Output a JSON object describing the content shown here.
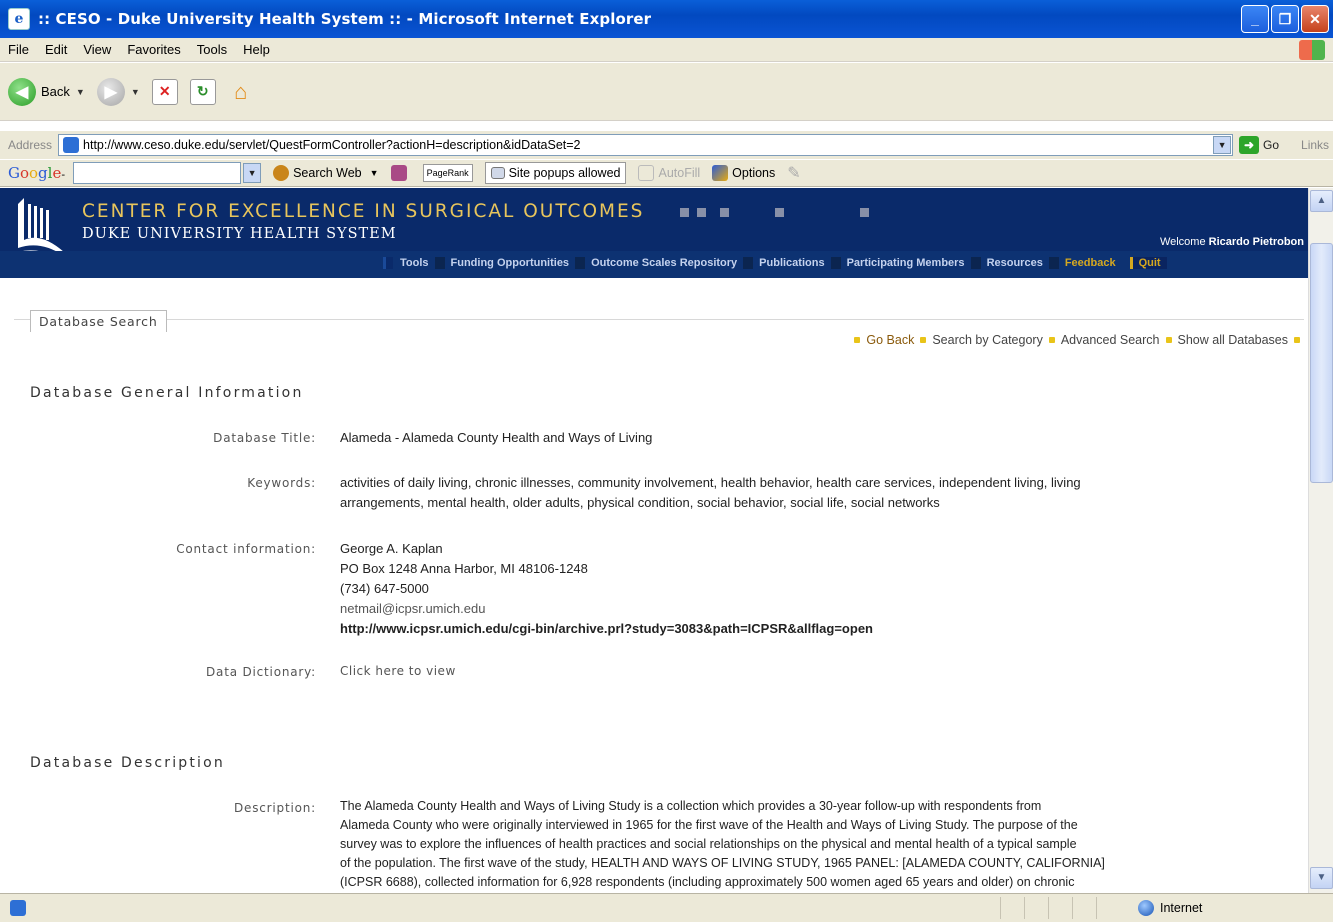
{
  "window": {
    "title": ":: CESO - Duke University Health System :: - Microsoft Internet Explorer",
    "app_icon": "ie-page-icon",
    "controls": [
      "minimize",
      "restore",
      "close"
    ]
  },
  "menu": [
    "File",
    "Edit",
    "View",
    "Favorites",
    "Tools",
    "Help"
  ],
  "toolbar": {
    "back_label": "Back"
  },
  "address": {
    "label": "Address",
    "url": "http://www.ceso.duke.edu/servlet/QuestFormController?actionH=description&idDataSet=2",
    "go_label": "Go",
    "links_label": "Links"
  },
  "google_toolbar": {
    "logo_parts": [
      "G",
      "o",
      "o",
      "g",
      "l",
      "e"
    ],
    "logo_suffix": "-",
    "search_web": "Search Web",
    "pagerank": "PageRank",
    "popups": "Site popups allowed",
    "autofill": "AutoFill",
    "options": "Options"
  },
  "banner": {
    "title": "CENTER FOR EXCELLENCE IN SURGICAL OUTCOMES",
    "subtitle": "DUKE UNIVERSITY HEALTH SYSTEM",
    "welcome_prefix": "Welcome",
    "welcome_user": "Ricardo Pietrobon"
  },
  "nav": {
    "items": [
      "Tools",
      "Funding Opportunities",
      "Outcome Scales Repository",
      "Publications",
      "Participating Members",
      "Resources"
    ],
    "feedback": "Feedback",
    "quit": "Quit"
  },
  "panel": {
    "tab_label": "Database Search",
    "quick_links": [
      "Go Back",
      "Search by Category",
      "Advanced Search",
      "Show all Databases"
    ]
  },
  "general": {
    "heading": "Database General Information",
    "title_label": "Database Title:",
    "title_value": "Alameda - Alameda County Health and Ways of Living",
    "keywords_label": "Keywords:",
    "keywords_line1": "activities of daily living, chronic illnesses, community involvement, health behavior, health care services, independent living, living",
    "keywords_line2": "arrangements, mental health, older adults, physical condition, social behavior, social life, social networks",
    "contact_label": "Contact information:",
    "contact_name": "George A. Kaplan",
    "contact_address": "PO Box 1248 Anna Harbor, MI 48106-1248",
    "contact_phone": "(734) 647-5000",
    "contact_email": "netmail@icpsr.umich.edu",
    "contact_url": "http://www.icpsr.umich.edu/cgi-bin/archive.prl?study=3083&path=ICPSR&allflag=open",
    "dictionary_label": "Data Dictionary:",
    "dictionary_link": "Click here to view"
  },
  "description": {
    "heading": "Database Description",
    "label": "Description:",
    "lines": [
      "The Alameda County Health and Ways of Living Study is a collection which provides a 30-year follow-up with respondents from",
      "Alameda County who were originally interviewed in 1965 for the first wave of the Health and Ways of Living Study. The purpose of the",
      "survey was to explore the influences of health practices and social relationships on the physical and mental health of a typical sample",
      "of the population. The first wave of the study, HEALTH AND WAYS OF LIVING STUDY, 1965 PANEL: [ALAMEDA COUNTY, CALIFORNIA]",
      "(ICPSR 6688), collected information for 6,928 respondents (including approximately 500 women aged 65 years and older) on chronic"
    ]
  },
  "status": {
    "zone": "Internet"
  },
  "colors": {
    "banner_bg": "#0a2a6a",
    "banner_title": "#e8c55c",
    "nav_bg": "#0d3272",
    "feedback": "#d4a820",
    "bullet": "#e9c419"
  }
}
